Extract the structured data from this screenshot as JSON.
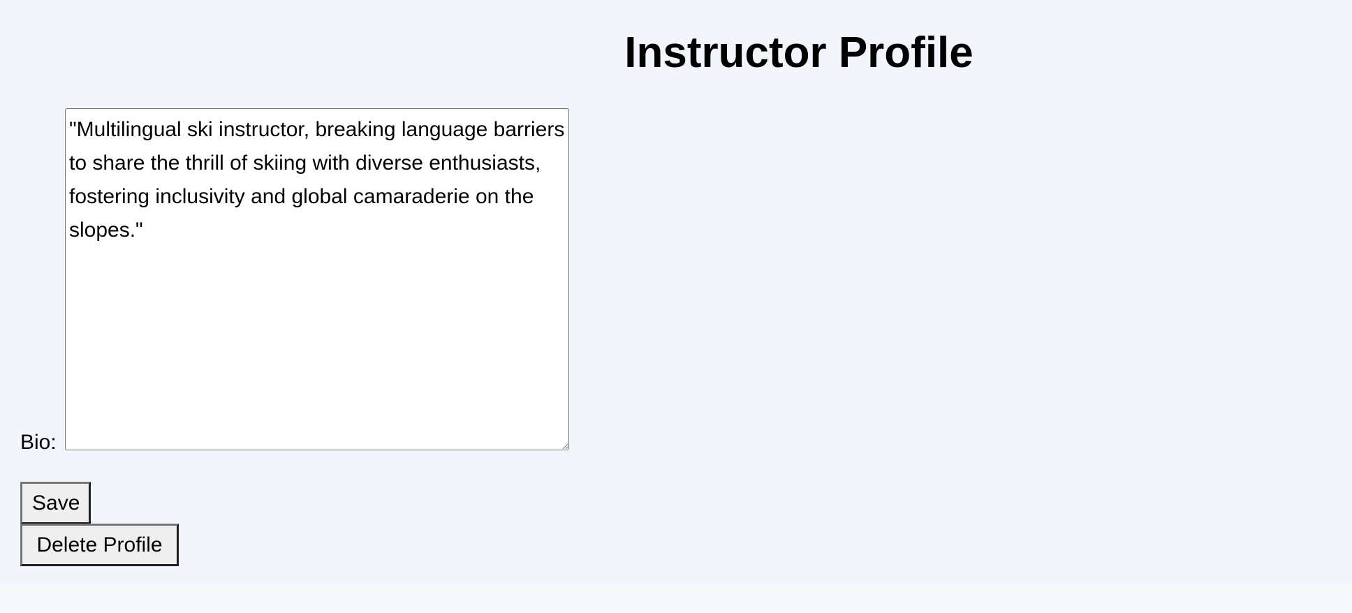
{
  "header": {
    "title": "Instructor Profile"
  },
  "form": {
    "bio_label": "Bio:",
    "bio_value": "\"Multilingual ski instructor, breaking language barriers to share the thrill of skiing with diverse enthusiasts, fostering inclusivity and global camaraderie on the slopes.\"",
    "save_label": "Save",
    "delete_label": "Delete Profile"
  },
  "colors": {
    "page_background": "#f2f6fc",
    "footer_strip": "#f7f8fa",
    "button_face": "#efefef"
  }
}
